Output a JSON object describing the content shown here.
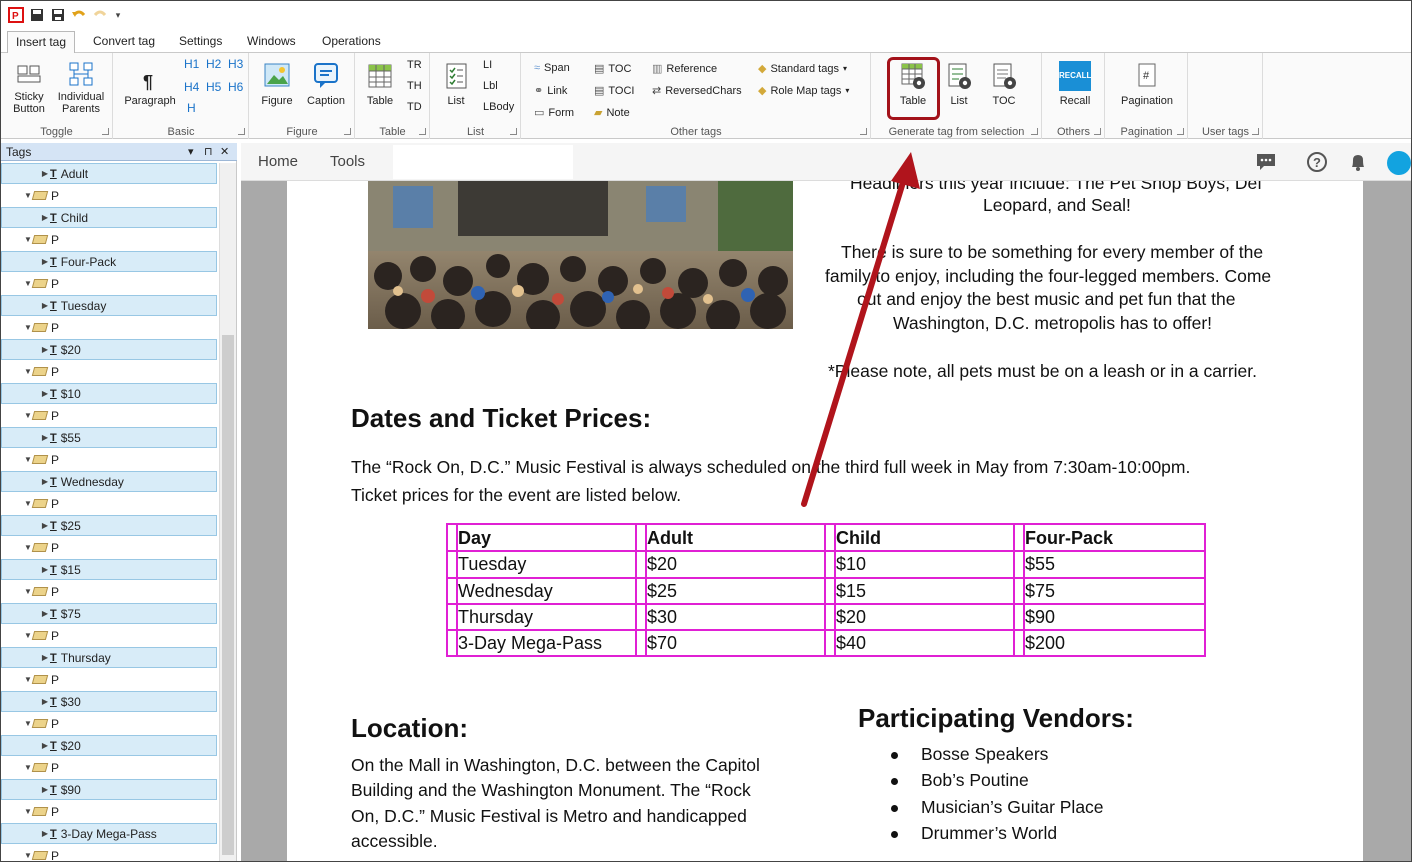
{
  "menu_tabs": [
    "Insert tag",
    "Convert tag",
    "Settings",
    "Windows",
    "Operations"
  ],
  "ribbon": {
    "toggle": {
      "sticky": [
        "Sticky",
        "Button"
      ],
      "individual": [
        "Individual",
        "Parents"
      ],
      "label": "Toggle"
    },
    "basic": {
      "paragraph": "Paragraph",
      "headings": [
        "H1",
        "H2",
        "H3",
        "H4",
        "H5",
        "H6",
        "H"
      ],
      "label": "Basic"
    },
    "figure": {
      "figure": "Figure",
      "caption": "Caption",
      "label": "Figure"
    },
    "table": {
      "table": "Table",
      "tr": "TR",
      "th": "TH",
      "td": "TD",
      "label": "Table"
    },
    "list": {
      "list": "List",
      "li": "LI",
      "lbl": "Lbl",
      "lbody": "LBody",
      "label": "List"
    },
    "other": {
      "span": "Span",
      "link": "Link",
      "form": "Form",
      "toc": "TOC",
      "toci": "TOCI",
      "note": "Note",
      "reference": "Reference",
      "reversed": "ReversedChars",
      "standard": "Standard tags",
      "rolemap": "Role Map tags",
      "label": "Other tags"
    },
    "generate": {
      "table": "Table",
      "list": "List",
      "toc": "TOC",
      "label": "Generate tag from selection"
    },
    "others": {
      "recall": "Recall",
      "recall_logo": "RECALL",
      "label": "Others"
    },
    "pagination": {
      "pagination": "Pagination",
      "label": "Pagination"
    },
    "usertags": {
      "label": "User tags"
    }
  },
  "tags_panel": {
    "title": "Tags",
    "items": [
      {
        "kind": "text",
        "label": "Adult"
      },
      {
        "kind": "p",
        "label": "P"
      },
      {
        "kind": "text",
        "label": "Child"
      },
      {
        "kind": "p",
        "label": "P"
      },
      {
        "kind": "text",
        "label": "Four-Pack"
      },
      {
        "kind": "p",
        "label": "P"
      },
      {
        "kind": "text",
        "label": "Tuesday"
      },
      {
        "kind": "p",
        "label": "P"
      },
      {
        "kind": "text",
        "label": "$20"
      },
      {
        "kind": "p",
        "label": "P"
      },
      {
        "kind": "text",
        "label": "$10"
      },
      {
        "kind": "p",
        "label": "P"
      },
      {
        "kind": "text",
        "label": "$55"
      },
      {
        "kind": "p",
        "label": "P"
      },
      {
        "kind": "text",
        "label": "Wednesday"
      },
      {
        "kind": "p",
        "label": "P"
      },
      {
        "kind": "text",
        "label": "$25"
      },
      {
        "kind": "p",
        "label": "P"
      },
      {
        "kind": "text",
        "label": "$15"
      },
      {
        "kind": "p",
        "label": "P"
      },
      {
        "kind": "text",
        "label": "$75"
      },
      {
        "kind": "p",
        "label": "P"
      },
      {
        "kind": "text",
        "label": "Thursday"
      },
      {
        "kind": "p",
        "label": "P"
      },
      {
        "kind": "text",
        "label": "$30"
      },
      {
        "kind": "p",
        "label": "P"
      },
      {
        "kind": "text",
        "label": "$20"
      },
      {
        "kind": "p",
        "label": "P"
      },
      {
        "kind": "text",
        "label": "$90"
      },
      {
        "kind": "p",
        "label": "P"
      },
      {
        "kind": "text",
        "label": "3-Day  Mega-Pass"
      },
      {
        "kind": "p",
        "label": "P"
      }
    ]
  },
  "doc_nav": {
    "home": "Home",
    "tools": "Tools"
  },
  "document": {
    "intro_lines": [
      "Headliners this year include: The Pet Shop Boys, Def",
      "Leopard, and Seal!",
      "There is sure to be something for every member of the",
      "family to enjoy, including the four-legged members.  Come",
      "out and enjoy the best music and pet fun that the",
      "Washington, D.C. metropolis has to offer!",
      "*Please note, all pets must be on a leash or in a carrier."
    ],
    "dates_heading": "Dates and Ticket Prices:",
    "dates_para": [
      "The “Rock On, D.C.” Music Festival is always scheduled on the third full week in May from 7:30am-10:00pm.",
      "Ticket prices for the event are listed below."
    ],
    "table": {
      "headers": [
        "Day",
        "Adult",
        "Child",
        "Four-Pack"
      ],
      "rows": [
        [
          "Tuesday",
          "$20",
          "$10",
          "$55"
        ],
        [
          "Wednesday",
          "$25",
          "$15",
          "$75"
        ],
        [
          "Thursday",
          "$30",
          "$20",
          "$90"
        ],
        [
          "3-Day Mega-Pass",
          "$70",
          "$40",
          "$200"
        ]
      ]
    },
    "location_heading": "Location:",
    "location_lines": [
      "On the Mall in Washington, D.C. between the Capitol",
      "Building and the Washington Monument.  The “Rock",
      "On, D.C.” Music Festival is Metro and handicapped",
      "accessible."
    ],
    "vendors_heading": "Participating Vendors:",
    "vendors": [
      "Bosse Speakers",
      "Bob’s Poutine",
      "Musician’s Guitar Place",
      "Drummer’s World"
    ]
  },
  "colors": {
    "tag_highlight": "#e020d4",
    "callout": "#a3121a",
    "accent": "#1a73c9"
  }
}
